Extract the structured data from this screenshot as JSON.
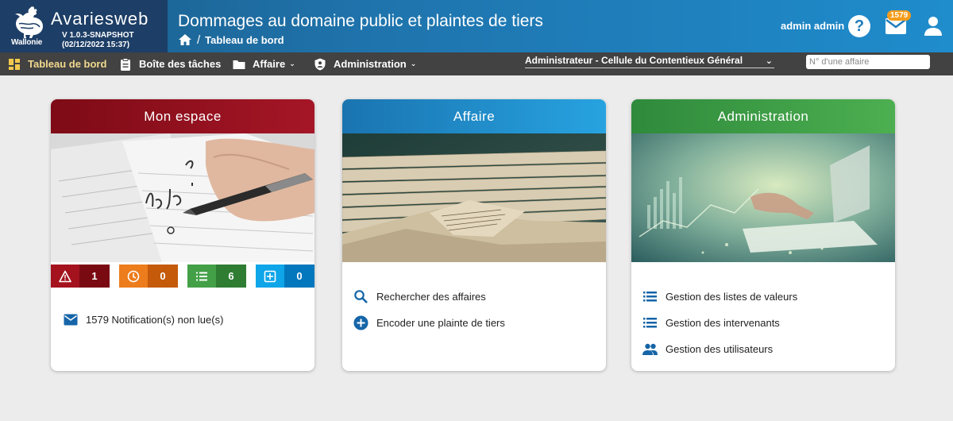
{
  "brand": {
    "app_name": "Avariesweb",
    "version": "V 1.0.3-SNAPSHOT",
    "build_date": "(02/12/2022 15:37)",
    "region": "Wallonie"
  },
  "header": {
    "title": "Dommages au domaine public et plaintes de tiers",
    "breadcrumb": {
      "separator": "/",
      "current": "Tableau de bord"
    },
    "user_name": "admin admin",
    "help_icon": "?",
    "mail_badge": "1579"
  },
  "navbar": {
    "items": [
      {
        "label": "Tableau de bord",
        "icon": "dashboard-icon",
        "active": true
      },
      {
        "label": "Boîte des tâches",
        "icon": "clipboard-icon"
      },
      {
        "label": "Affaire",
        "icon": "folder-icon",
        "dropdown": true
      },
      {
        "label": "Administration",
        "icon": "shield-icon",
        "dropdown": true
      }
    ],
    "chevron": "⌄",
    "role_select": {
      "value": "Administrateur - Cellule du Contentieux Général"
    },
    "affaire_search": {
      "placeholder": "N° d'une affaire",
      "value": ""
    }
  },
  "cards": {
    "mon_espace": {
      "title": "Mon espace",
      "color": "#8b0d1a",
      "counters": [
        {
          "icon": "warning-icon",
          "value": "1",
          "color_icon": "#a4121e",
          "color_num": "#7a0a12"
        },
        {
          "icon": "clock-icon",
          "value": "0",
          "color_icon": "#ec7c1c",
          "color_num": "#c45a0a"
        },
        {
          "icon": "list-icon",
          "value": "6",
          "color_icon": "#43a047",
          "color_num": "#2e7d32"
        },
        {
          "icon": "add-box-icon",
          "value": "0",
          "color_icon": "#0ea5e9",
          "color_num": "#0277bd"
        }
      ],
      "notification": "1579 Notification(s) non lue(s)"
    },
    "affaire": {
      "title": "Affaire",
      "color": "#1a87c7",
      "links": [
        {
          "icon": "search-icon",
          "label": "Rechercher des affaires"
        },
        {
          "icon": "add-circle-icon",
          "label": "Encoder une plainte de tiers"
        }
      ]
    },
    "administration": {
      "title": "Administration",
      "color": "#3f9d46",
      "links": [
        {
          "icon": "list-icon",
          "label": "Gestion des listes de valeurs"
        },
        {
          "icon": "list-icon",
          "label": "Gestion des intervenants"
        },
        {
          "icon": "people-icon",
          "label": "Gestion des utilisateurs"
        }
      ]
    }
  }
}
